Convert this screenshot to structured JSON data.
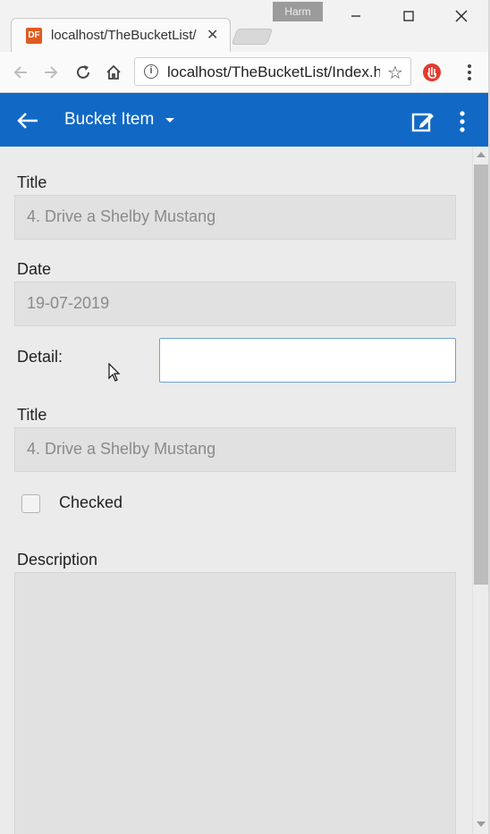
{
  "browser": {
    "profile_name": "Harm",
    "tab": {
      "favicon_text": "DF",
      "title": "localhost/TheBucketList/",
      "close": "✕"
    },
    "address": {
      "url": "localhost/TheBucketList/Index.h"
    }
  },
  "appbar": {
    "title": "Bucket Item",
    "color": "#1169c5"
  },
  "form": {
    "title_label_1": "Title",
    "title_value_1": "4. Drive a Shelby Mustang",
    "date_label": "Date",
    "date_value": "19-07-2019",
    "detail_label": "Detail:",
    "detail_value": "",
    "title_label_2": "Title",
    "title_value_2": "4. Drive a Shelby Mustang",
    "checked_label": "Checked",
    "checked": false,
    "description_label": "Description",
    "description_value": ""
  }
}
